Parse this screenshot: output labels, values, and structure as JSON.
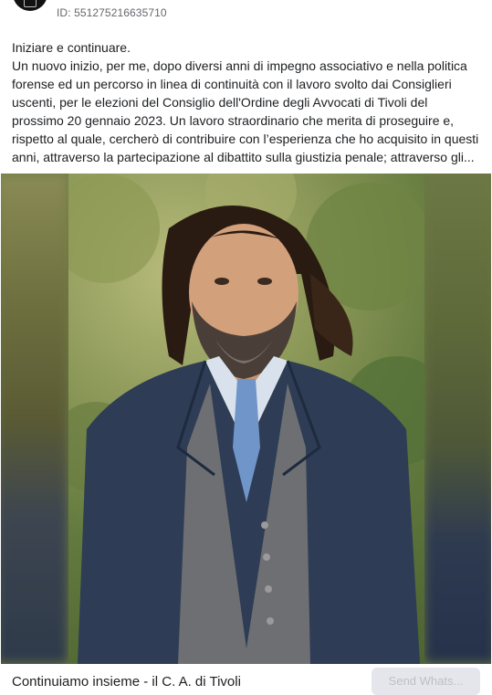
{
  "header": {
    "ad_id": "ID: 551275216635710",
    "avatar_icon": "page-logo-icon"
  },
  "body": {
    "lines": [
      "Iniziare e continuare.",
      "Un nuovo inizio, per me, dopo diversi anni di impegno associativo e nella politica",
      "forense ed un percorso in linea di continuità con il lavoro svolto dai Consiglieri",
      "uscenti, per le elezioni del Consiglio dell'Ordine degli Avvocati di Tivoli del",
      "prossimo 20 gennaio 2023. Un lavoro straordinario che merita di proseguire e,",
      "rispetto al quale, cercherò di contribuire con l’esperienza che ho acquisito in questi",
      "anni, attraverso la partecipazione al dibattito sulla giustizia penale; attraverso gli..."
    ]
  },
  "media": {
    "description_icon": "portrait-photo"
  },
  "footer": {
    "caption": "Continuiamo insieme - il C. A. di Tivoli",
    "cta_label": "Send Whats..."
  }
}
